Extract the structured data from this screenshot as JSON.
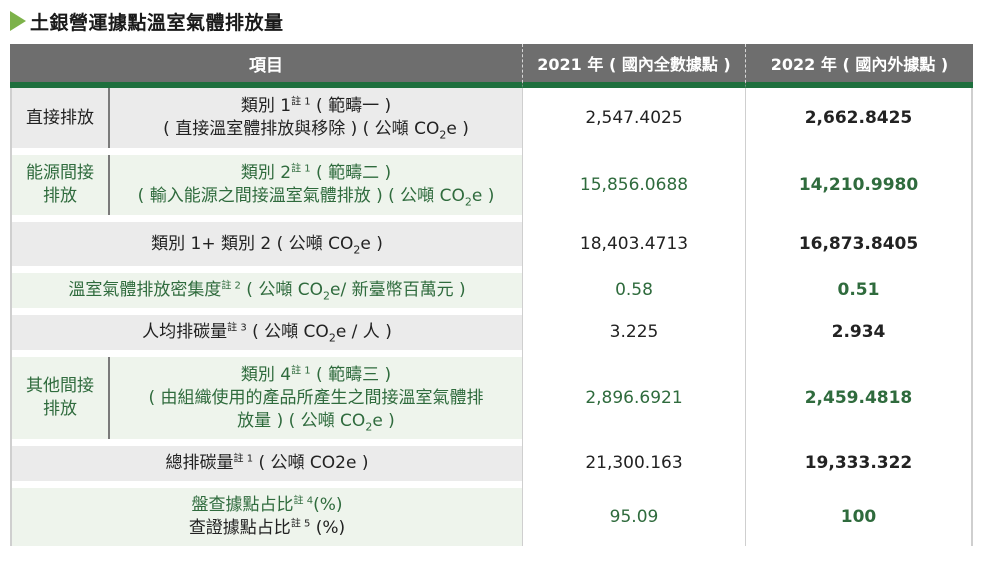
{
  "title": "土銀營運據點溫室氣體排放量",
  "headers": {
    "item": "項目",
    "y2021": "2021 年 ( 國內全數據點 )",
    "y2022": "2022 年 ( 國內外據點 )"
  },
  "rows": {
    "direct": {
      "label": "直接排放",
      "desc_l1_a": "類別 1",
      "desc_l1_note": "註 1",
      "desc_l1_b": " ( 範疇一 )",
      "desc_l2_a": "( 直接溫室體排放與移除 ) ( 公噸 CO",
      "desc_sub": "2",
      "desc_l2_b": "e )",
      "v2021": "2,547.4025",
      "v2022": "2,662.8425"
    },
    "energy": {
      "label": "能源間接排放",
      "desc_l1_a": "類別 2",
      "desc_l1_note": "註 1",
      "desc_l1_b": " ( 範疇二 )",
      "desc_l2_a": "( 輸入能源之間接溫室氣體排放 ) ( 公噸 CO",
      "desc_sub": "2",
      "desc_l2_b": "e )",
      "v2021": "15,856.0688",
      "v2022": "14,210.9980"
    },
    "sum12": {
      "text_a": "類別 1+ 類別 2 ( 公噸 CO",
      "sub": "2",
      "text_b": "e  )",
      "v2021": "18,403.4713",
      "v2022": "16,873.8405"
    },
    "intensity": {
      "text_a": "溫室氣體排放密集度",
      "note": "註 2",
      "text_b": " ( 公噸 CO",
      "sub": "2",
      "text_c": "e/ 新臺幣百萬元 )",
      "v2021": "0.58",
      "v2022": "0.51"
    },
    "percapita": {
      "text_a": "人均排碳量",
      "note": "註 3",
      "text_b": " ( 公噸 CO",
      "sub": "2",
      "text_c": "e / 人 )",
      "v2021": "3.225",
      "v2022": "2.934"
    },
    "other": {
      "label": "其他間接排放",
      "desc_l1_a": "類別 4",
      "desc_l1_note": "註 1",
      "desc_l1_b": " ( 範疇三 )",
      "desc_l2": "( 由組織使用的產品所產生之間接溫室氣體排",
      "desc_l3_a": "放量 ) ( 公噸 CO",
      "desc_sub": "2",
      "desc_l3_b": "e  )",
      "v2021": "2,896.6921",
      "v2022": "2,459.4818"
    },
    "total": {
      "text_a": "總排碳量",
      "note": "註 1",
      "text_b": " ( 公噸 CO2e )",
      "v2021": "21,300.163",
      "v2022": "19,333.322"
    },
    "ratio": {
      "l1_a": "盤查據點占比",
      "l1_note": "註 4",
      "l1_b": "(%)",
      "l2_a": "查證據點占比",
      "l2_note": "註 5",
      "l2_b": " (%)",
      "v2021": "95.09",
      "v2022": "100"
    }
  },
  "colors": {
    "accent": "#7db24a",
    "header_bg": "#6e6e6e",
    "header_rule": "#1e6f3d",
    "green_text": "#2f6b3d",
    "gray_row": "#ebebeb",
    "green_row": "#eef4ec"
  }
}
